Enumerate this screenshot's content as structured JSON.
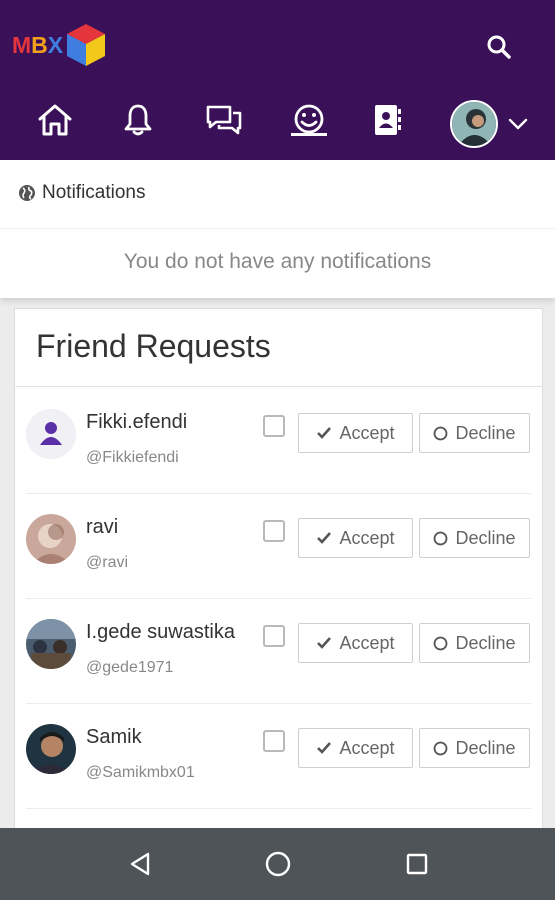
{
  "app": {
    "logo_letters": [
      "M",
      "B",
      "X"
    ]
  },
  "colors": {
    "header_bg": "#3a1158",
    "accent_red": "#e5353c",
    "accent_orange": "#f2a21a",
    "accent_blue": "#3f7ee0"
  },
  "nav": {
    "items": [
      "home-icon",
      "bell-icon",
      "chat-icon",
      "smiley-icon",
      "contacts-icon"
    ],
    "active": "smiley-icon"
  },
  "notifications": {
    "title": "Notifications",
    "empty_text": "You do not have any notifications"
  },
  "friend_requests": {
    "title": "Friend Requests",
    "accept_label": "Accept",
    "decline_label": "Decline",
    "items": [
      {
        "name": "Fikki.efendi",
        "handle": "@Fikkiefendi"
      },
      {
        "name": "ravi",
        "handle": "@ravi"
      },
      {
        "name": "I.gede suwastika",
        "handle": "@gede1971"
      },
      {
        "name": "Samik",
        "handle": "@Samikmbx01"
      }
    ]
  },
  "system_nav": [
    "back-icon",
    "home-circle-icon",
    "recents-icon"
  ]
}
